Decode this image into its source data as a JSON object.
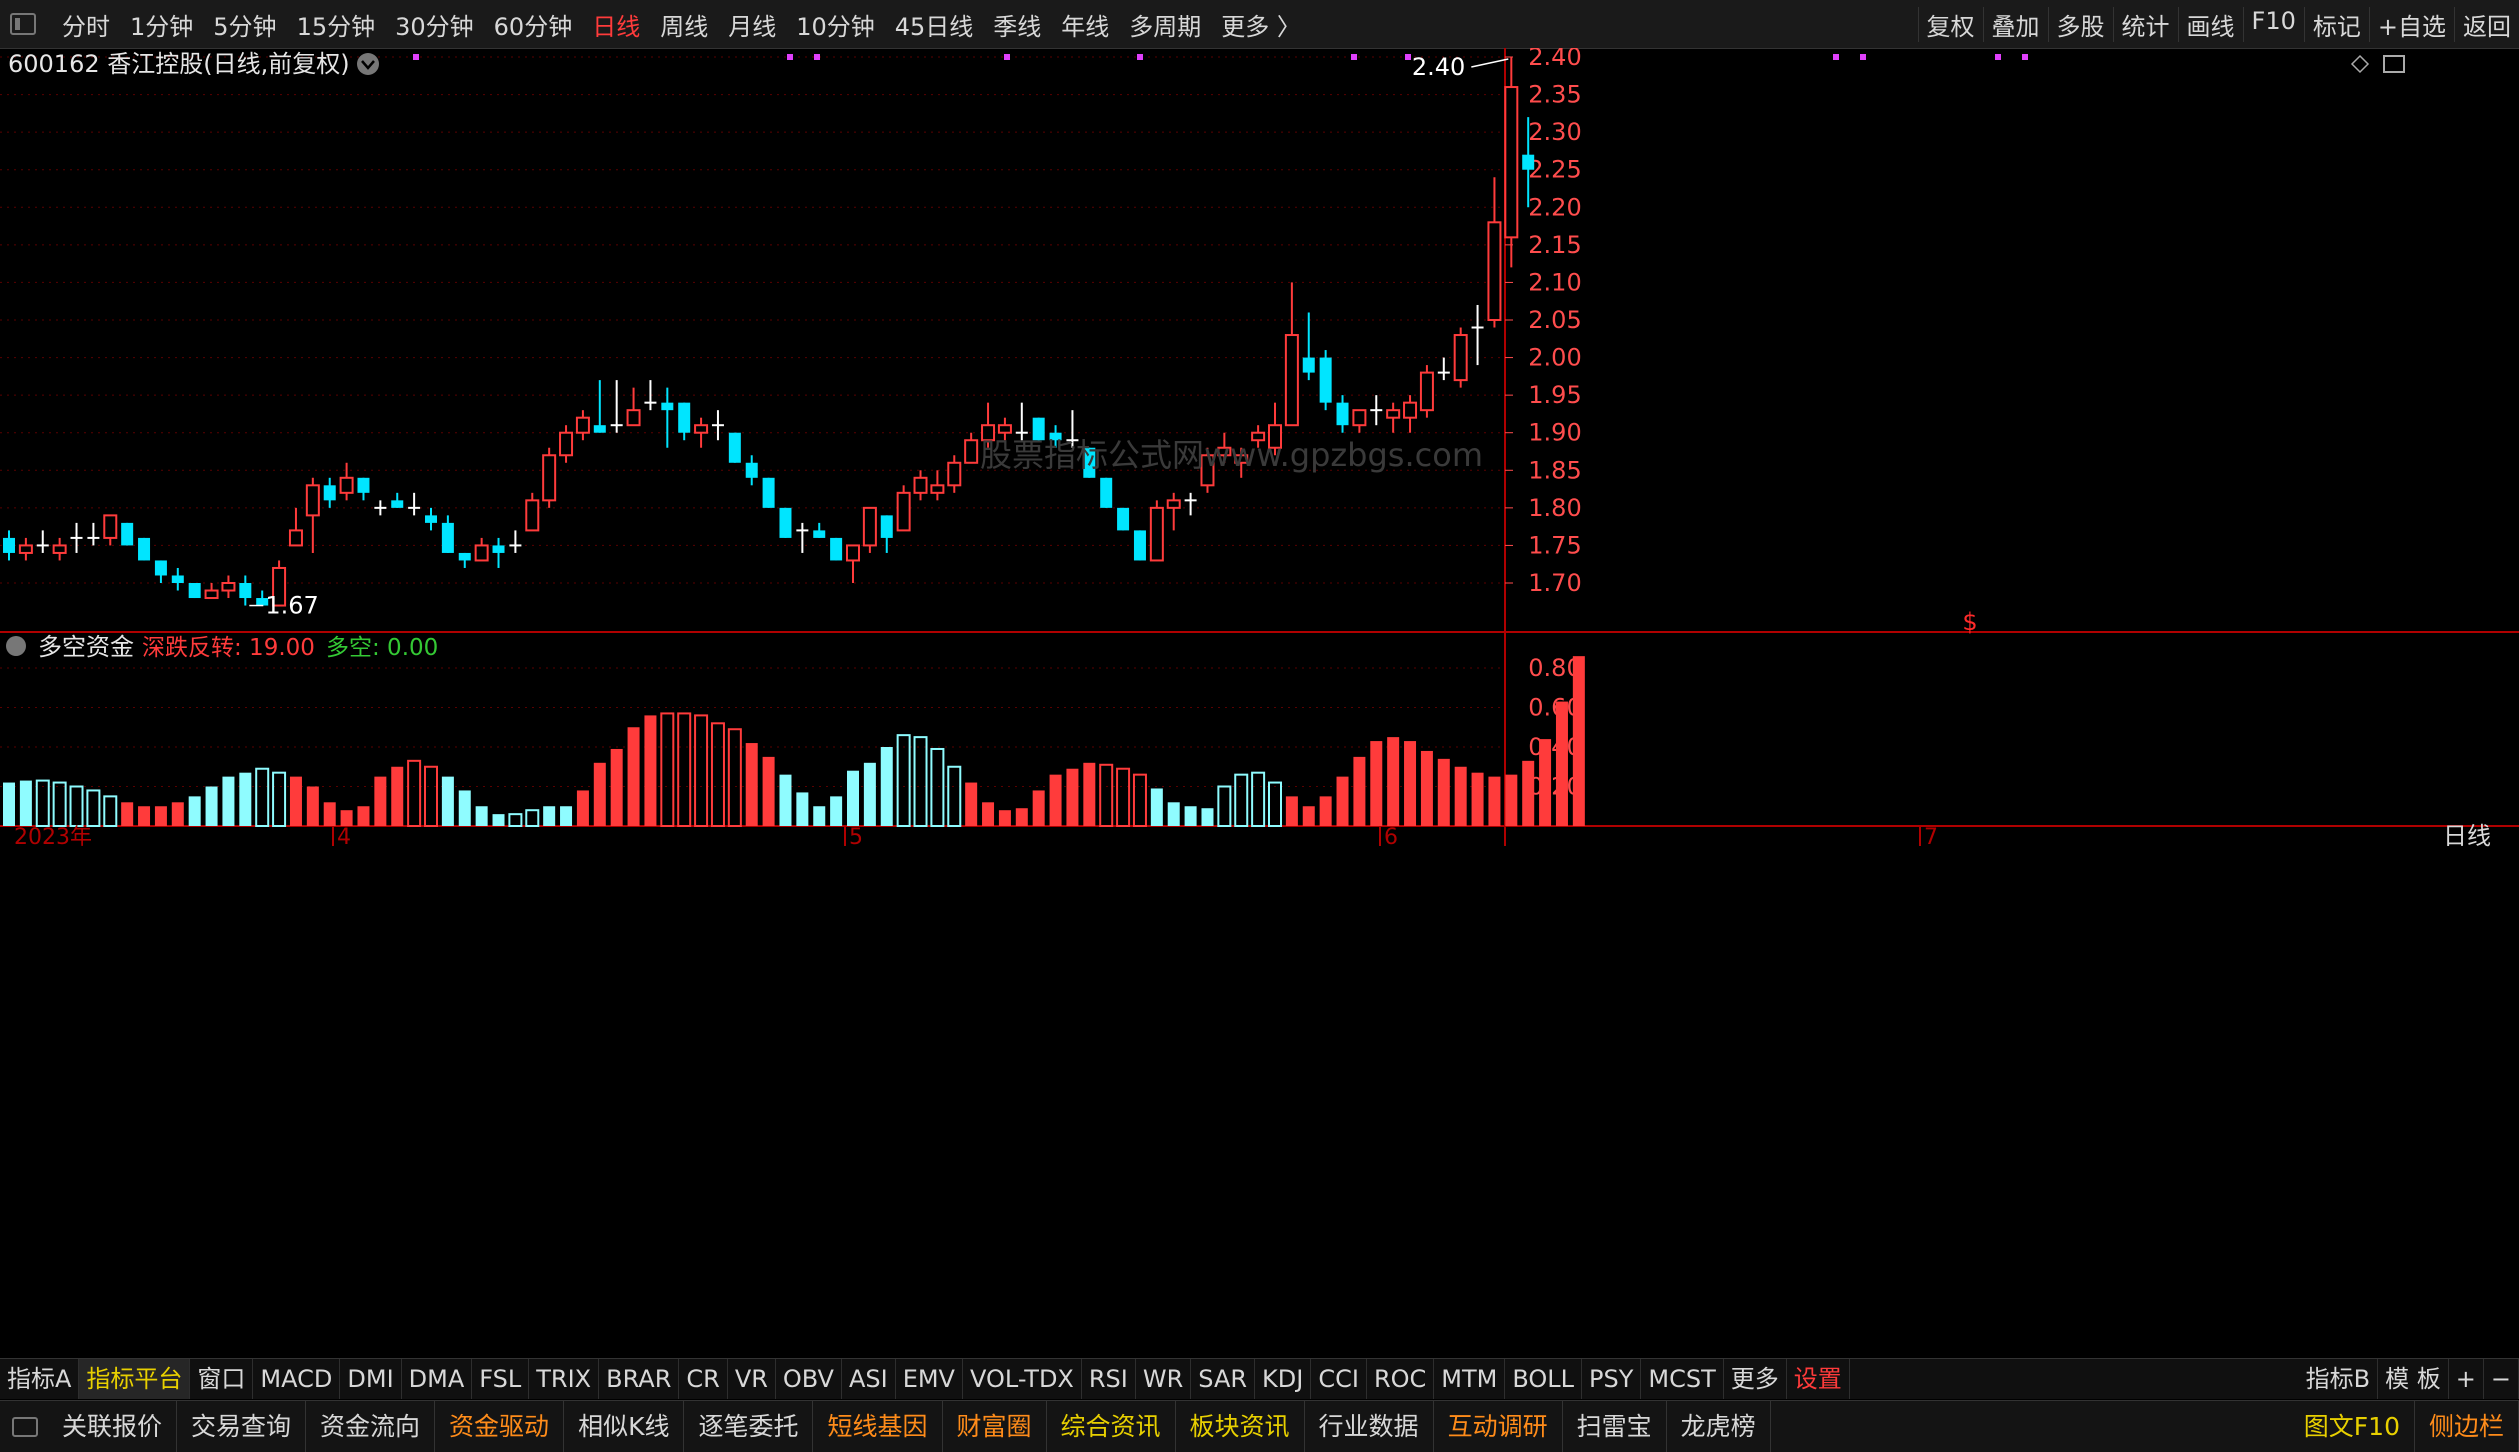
{
  "top_menu": {
    "periods": [
      "分时",
      "1分钟",
      "5分钟",
      "15分钟",
      "30分钟",
      "60分钟",
      "日线",
      "周线",
      "月线",
      "10分钟",
      "45日线",
      "季线",
      "年线",
      "多周期",
      "更多 〉"
    ],
    "active_period": "日线",
    "right_buttons": [
      "复权",
      "叠加",
      "多股",
      "统计",
      "画线",
      "F10",
      "标记",
      "+自选",
      "返回"
    ]
  },
  "main_panel": {
    "title": "600162 香江控股(日线,前复权)",
    "high_label": "2.40",
    "low_label": "1.67",
    "watermark": "股票指标公式网www.gpzbgs.com",
    "signal_marker": "$",
    "colors": {
      "up": "#ff3b3b",
      "down": "#00e5ff",
      "neutral": "#ffffff",
      "grid": "#5a0000",
      "axis": "#ff4d4d",
      "marker": "#e040fb"
    }
  },
  "indicator_panel": {
    "name": "多空资金",
    "line1_label": "深跌反转: 19.00",
    "line2_label": "多空: 0.00"
  },
  "time_axis": {
    "year_label": "2023年",
    "month_labels": [
      "4",
      "5",
      "6",
      "7"
    ],
    "period_label": "日线"
  },
  "chart_data": {
    "type": "candlestick",
    "y_axis_main": [
      "2.40",
      "2.35",
      "2.30",
      "2.25",
      "2.20",
      "2.15",
      "2.10",
      "2.05",
      "2.00",
      "1.95",
      "1.90",
      "1.85",
      "1.80",
      "1.75",
      "1.70"
    ],
    "y_axis_indicator": [
      "0.80",
      "0.60",
      "0.40",
      "0.20"
    ],
    "candles": [
      {
        "o": 1.76,
        "h": 1.77,
        "l": 1.73,
        "c": 1.74
      },
      {
        "o": 1.74,
        "h": 1.76,
        "l": 1.73,
        "c": 1.75
      },
      {
        "o": 1.75,
        "h": 1.77,
        "l": 1.74,
        "c": 1.75
      },
      {
        "o": 1.74,
        "h": 1.76,
        "l": 1.73,
        "c": 1.75
      },
      {
        "o": 1.76,
        "h": 1.78,
        "l": 1.74,
        "c": 1.76
      },
      {
        "o": 1.76,
        "h": 1.78,
        "l": 1.75,
        "c": 1.76
      },
      {
        "o": 1.76,
        "h": 1.79,
        "l": 1.75,
        "c": 1.79
      },
      {
        "o": 1.78,
        "h": 1.78,
        "l": 1.75,
        "c": 1.75
      },
      {
        "o": 1.76,
        "h": 1.76,
        "l": 1.73,
        "c": 1.73
      },
      {
        "o": 1.73,
        "h": 1.73,
        "l": 1.7,
        "c": 1.71
      },
      {
        "o": 1.71,
        "h": 1.72,
        "l": 1.69,
        "c": 1.7
      },
      {
        "o": 1.7,
        "h": 1.7,
        "l": 1.68,
        "c": 1.68
      },
      {
        "o": 1.68,
        "h": 1.7,
        "l": 1.68,
        "c": 1.69
      },
      {
        "o": 1.69,
        "h": 1.71,
        "l": 1.68,
        "c": 1.7
      },
      {
        "o": 1.7,
        "h": 1.71,
        "l": 1.67,
        "c": 1.68
      },
      {
        "o": 1.68,
        "h": 1.69,
        "l": 1.67,
        "c": 1.67
      },
      {
        "o": 1.67,
        "h": 1.73,
        "l": 1.67,
        "c": 1.72
      },
      {
        "o": 1.75,
        "h": 1.8,
        "l": 1.75,
        "c": 1.77
      },
      {
        "o": 1.79,
        "h": 1.84,
        "l": 1.74,
        "c": 1.83
      },
      {
        "o": 1.83,
        "h": 1.84,
        "l": 1.8,
        "c": 1.81
      },
      {
        "o": 1.82,
        "h": 1.86,
        "l": 1.81,
        "c": 1.84
      },
      {
        "o": 1.84,
        "h": 1.84,
        "l": 1.81,
        "c": 1.82
      },
      {
        "o": 1.8,
        "h": 1.81,
        "l": 1.79,
        "c": 1.8
      },
      {
        "o": 1.81,
        "h": 1.82,
        "l": 1.8,
        "c": 1.8
      },
      {
        "o": 1.8,
        "h": 1.82,
        "l": 1.79,
        "c": 1.8
      },
      {
        "o": 1.79,
        "h": 1.8,
        "l": 1.77,
        "c": 1.78
      },
      {
        "o": 1.78,
        "h": 1.79,
        "l": 1.74,
        "c": 1.74
      },
      {
        "o": 1.74,
        "h": 1.74,
        "l": 1.72,
        "c": 1.73
      },
      {
        "o": 1.73,
        "h": 1.76,
        "l": 1.73,
        "c": 1.75
      },
      {
        "o": 1.75,
        "h": 1.76,
        "l": 1.72,
        "c": 1.74
      },
      {
        "o": 1.75,
        "h": 1.77,
        "l": 1.74,
        "c": 1.75
      },
      {
        "o": 1.77,
        "h": 1.82,
        "l": 1.77,
        "c": 1.81
      },
      {
        "o": 1.81,
        "h": 1.88,
        "l": 1.8,
        "c": 1.87
      },
      {
        "o": 1.87,
        "h": 1.91,
        "l": 1.86,
        "c": 1.9
      },
      {
        "o": 1.9,
        "h": 1.93,
        "l": 1.89,
        "c": 1.92
      },
      {
        "o": 1.91,
        "h": 1.97,
        "l": 1.9,
        "c": 1.9
      },
      {
        "o": 1.91,
        "h": 1.97,
        "l": 1.9,
        "c": 1.91
      },
      {
        "o": 1.91,
        "h": 1.96,
        "l": 1.91,
        "c": 1.93
      },
      {
        "o": 1.94,
        "h": 1.97,
        "l": 1.93,
        "c": 1.94
      },
      {
        "o": 1.94,
        "h": 1.96,
        "l": 1.88,
        "c": 1.93
      },
      {
        "o": 1.94,
        "h": 1.94,
        "l": 1.89,
        "c": 1.9
      },
      {
        "o": 1.9,
        "h": 1.92,
        "l": 1.88,
        "c": 1.91
      },
      {
        "o": 1.91,
        "h": 1.93,
        "l": 1.89,
        "c": 1.91
      },
      {
        "o": 1.9,
        "h": 1.9,
        "l": 1.86,
        "c": 1.86
      },
      {
        "o": 1.86,
        "h": 1.87,
        "l": 1.83,
        "c": 1.84
      },
      {
        "o": 1.84,
        "h": 1.84,
        "l": 1.8,
        "c": 1.8
      },
      {
        "o": 1.8,
        "h": 1.8,
        "l": 1.76,
        "c": 1.76
      },
      {
        "o": 1.77,
        "h": 1.78,
        "l": 1.74,
        "c": 1.77
      },
      {
        "o": 1.77,
        "h": 1.78,
        "l": 1.76,
        "c": 1.76
      },
      {
        "o": 1.76,
        "h": 1.76,
        "l": 1.73,
        "c": 1.73
      },
      {
        "o": 1.73,
        "h": 1.75,
        "l": 1.7,
        "c": 1.75
      },
      {
        "o": 1.75,
        "h": 1.8,
        "l": 1.74,
        "c": 1.8
      },
      {
        "o": 1.79,
        "h": 1.79,
        "l": 1.74,
        "c": 1.76
      },
      {
        "o": 1.77,
        "h": 1.83,
        "l": 1.77,
        "c": 1.82
      },
      {
        "o": 1.82,
        "h": 1.85,
        "l": 1.81,
        "c": 1.84
      },
      {
        "o": 1.82,
        "h": 1.85,
        "l": 1.81,
        "c": 1.83
      },
      {
        "o": 1.83,
        "h": 1.87,
        "l": 1.82,
        "c": 1.86
      },
      {
        "o": 1.86,
        "h": 1.9,
        "l": 1.86,
        "c": 1.89
      },
      {
        "o": 1.89,
        "h": 1.94,
        "l": 1.88,
        "c": 1.91
      },
      {
        "o": 1.9,
        "h": 1.92,
        "l": 1.89,
        "c": 1.91
      },
      {
        "o": 1.9,
        "h": 1.94,
        "l": 1.89,
        "c": 1.9
      },
      {
        "o": 1.92,
        "h": 1.92,
        "l": 1.89,
        "c": 1.89
      },
      {
        "o": 1.9,
        "h": 1.91,
        "l": 1.88,
        "c": 1.89
      },
      {
        "o": 1.89,
        "h": 1.93,
        "l": 1.88,
        "c": 1.89
      },
      {
        "o": 1.88,
        "h": 1.88,
        "l": 1.84,
        "c": 1.84
      },
      {
        "o": 1.84,
        "h": 1.84,
        "l": 1.8,
        "c": 1.8
      },
      {
        "o": 1.8,
        "h": 1.8,
        "l": 1.77,
        "c": 1.77
      },
      {
        "o": 1.77,
        "h": 1.77,
        "l": 1.73,
        "c": 1.73
      },
      {
        "o": 1.73,
        "h": 1.81,
        "l": 1.73,
        "c": 1.8
      },
      {
        "o": 1.8,
        "h": 1.82,
        "l": 1.77,
        "c": 1.81
      },
      {
        "o": 1.81,
        "h": 1.82,
        "l": 1.79,
        "c": 1.81
      },
      {
        "o": 1.83,
        "h": 1.88,
        "l": 1.82,
        "c": 1.87
      },
      {
        "o": 1.87,
        "h": 1.9,
        "l": 1.86,
        "c": 1.88
      },
      {
        "o": 1.86,
        "h": 1.88,
        "l": 1.84,
        "c": 1.87
      },
      {
        "o": 1.89,
        "h": 1.91,
        "l": 1.88,
        "c": 1.9
      },
      {
        "o": 1.88,
        "h": 1.94,
        "l": 1.87,
        "c": 1.91
      },
      {
        "o": 1.91,
        "h": 2.1,
        "l": 1.91,
        "c": 2.03
      },
      {
        "o": 2.0,
        "h": 2.06,
        "l": 1.97,
        "c": 1.98
      },
      {
        "o": 2.0,
        "h": 2.01,
        "l": 1.93,
        "c": 1.94
      },
      {
        "o": 1.94,
        "h": 1.95,
        "l": 1.9,
        "c": 1.91
      },
      {
        "o": 1.91,
        "h": 1.93,
        "l": 1.9,
        "c": 1.93
      },
      {
        "o": 1.93,
        "h": 1.95,
        "l": 1.91,
        "c": 1.93
      },
      {
        "o": 1.92,
        "h": 1.94,
        "l": 1.9,
        "c": 1.93
      },
      {
        "o": 1.92,
        "h": 1.95,
        "l": 1.9,
        "c": 1.94
      },
      {
        "o": 1.93,
        "h": 1.99,
        "l": 1.92,
        "c": 1.98
      },
      {
        "o": 1.98,
        "h": 2.0,
        "l": 1.97,
        "c": 1.98
      },
      {
        "o": 1.97,
        "h": 2.04,
        "l": 1.96,
        "c": 2.03
      },
      {
        "o": 2.04,
        "h": 2.07,
        "l": 1.99,
        "c": 2.04
      },
      {
        "o": 2.05,
        "h": 2.24,
        "l": 2.04,
        "c": 2.18
      },
      {
        "o": 2.16,
        "h": 2.4,
        "l": 2.12,
        "c": 2.36
      },
      {
        "o": 2.27,
        "h": 2.32,
        "l": 2.2,
        "c": 2.25
      }
    ],
    "indicator_values": [
      0.22,
      0.23,
      0.23,
      0.22,
      0.2,
      0.18,
      0.15,
      0.12,
      0.1,
      0.1,
      0.12,
      0.15,
      0.2,
      0.25,
      0.27,
      0.29,
      0.27,
      0.25,
      0.2,
      0.12,
      0.08,
      0.1,
      0.25,
      0.3,
      0.33,
      0.3,
      0.25,
      0.18,
      0.1,
      0.06,
      0.06,
      0.08,
      0.1,
      0.1,
      0.18,
      0.32,
      0.39,
      0.5,
      0.56,
      0.57,
      0.57,
      0.56,
      0.52,
      0.49,
      0.42,
      0.35,
      0.26,
      0.17,
      0.1,
      0.15,
      0.28,
      0.32,
      0.4,
      0.46,
      0.45,
      0.39,
      0.3,
      0.22,
      0.12,
      0.08,
      0.09,
      0.18,
      0.26,
      0.29,
      0.32,
      0.31,
      0.29,
      0.26,
      0.19,
      0.12,
      0.1,
      0.09,
      0.2,
      0.26,
      0.27,
      0.22,
      0.15,
      0.1,
      0.15,
      0.25,
      0.35,
      0.43,
      0.45,
      0.43,
      0.38,
      0.34,
      0.3,
      0.27,
      0.25,
      0.26,
      0.33,
      0.44,
      0.63,
      0.86
    ],
    "indicator_colors": [
      "c",
      "c",
      "c",
      "c",
      "c",
      "c",
      "c",
      "r",
      "r",
      "r",
      "r",
      "c",
      "c",
      "c",
      "c",
      "c",
      "c",
      "r",
      "r",
      "r",
      "r",
      "r",
      "r",
      "r",
      "r",
      "r",
      "c",
      "c",
      "c",
      "c",
      "c",
      "c",
      "c",
      "c",
      "r",
      "r",
      "r",
      "r",
      "r",
      "r",
      "r",
      "r",
      "r",
      "r",
      "r",
      "r",
      "c",
      "c",
      "c",
      "c",
      "c",
      "c",
      "c",
      "c",
      "c",
      "c",
      "c",
      "r",
      "r",
      "r",
      "r",
      "r",
      "r",
      "r",
      "r",
      "r",
      "r",
      "r",
      "c",
      "c",
      "c",
      "c",
      "c",
      "c",
      "c",
      "c",
      "r",
      "r",
      "r",
      "r",
      "r",
      "r",
      "r",
      "r",
      "r",
      "r",
      "r",
      "r",
      "r",
      "r",
      "r",
      "r",
      "r",
      "r"
    ],
    "indicator_hollow": [
      false,
      false,
      true,
      true,
      true,
      true,
      true,
      false,
      false,
      false,
      false,
      false,
      false,
      false,
      false,
      true,
      true,
      false,
      false,
      false,
      false,
      false,
      false,
      false,
      true,
      true,
      false,
      false,
      false,
      false,
      true,
      true,
      false,
      false,
      false,
      false,
      false,
      false,
      false,
      true,
      true,
      true,
      true,
      true,
      false,
      false,
      false,
      false,
      false,
      false,
      false,
      false,
      false,
      true,
      true,
      true,
      true,
      false,
      false,
      false,
      false,
      false,
      false,
      false,
      false,
      true,
      true,
      true,
      false,
      false,
      false,
      false,
      true,
      true,
      true,
      true,
      false,
      false,
      false,
      false,
      false,
      false,
      false,
      false,
      false,
      false,
      false,
      false,
      false,
      false,
      false,
      false,
      false,
      false
    ]
  },
  "bottom_tabs": {
    "left": [
      "指标A",
      "指标平台",
      "窗口",
      "MACD",
      "DMI",
      "DMA",
      "FSL",
      "TRIX",
      "BRAR",
      "CR",
      "VR",
      "OBV",
      "ASI",
      "EMV",
      "VOL-TDX",
      "RSI",
      "WR",
      "SAR",
      "KDJ",
      "CCI",
      "ROC",
      "MTM",
      "BOLL",
      "PSY",
      "MCST",
      "更多",
      "设置"
    ],
    "right": [
      "指标B",
      "模 板",
      "+",
      "−"
    ]
  },
  "bottom_links": {
    "items": [
      "关联报价",
      "交易查询",
      "资金流向",
      "资金驱动",
      "相似K线",
      "逐笔委托",
      "短线基因",
      "财富圈",
      "综合资讯",
      "板块资讯",
      "行业数据",
      "互动调研",
      "扫雷宝",
      "龙虎榜"
    ],
    "right": [
      "图文F10",
      "侧边栏"
    ]
  }
}
